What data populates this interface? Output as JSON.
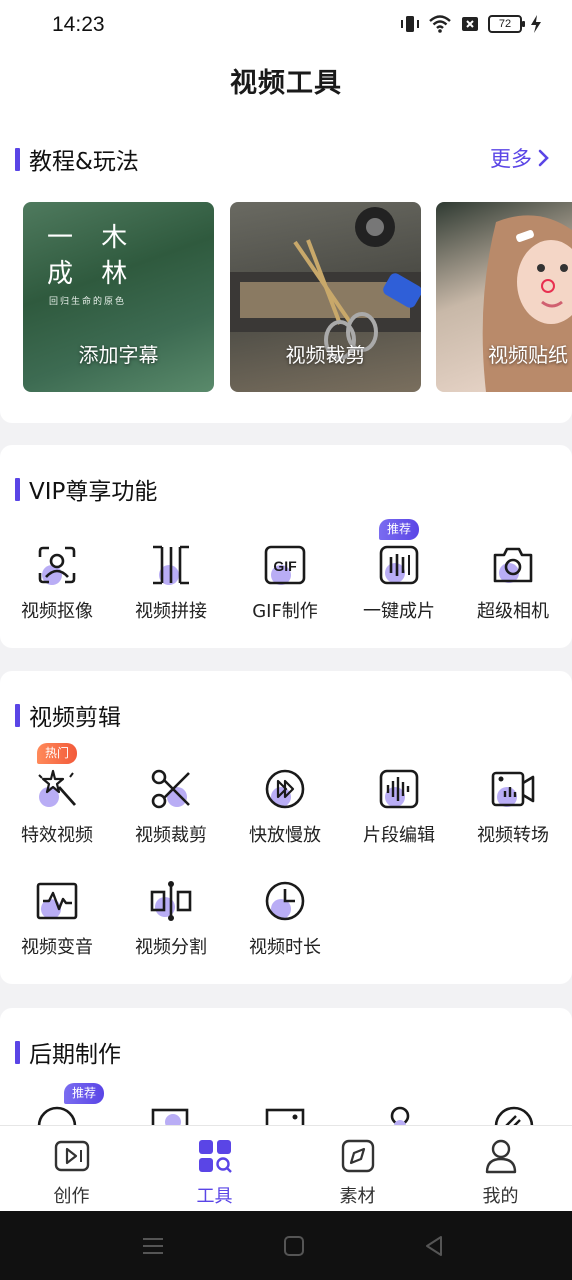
{
  "status": {
    "time": "14:23",
    "battery": "72"
  },
  "title": "视频工具",
  "tutorials": {
    "title": "教程&玩法",
    "more": "更多",
    "forest_line1": "一 木",
    "forest_line2": "成 林",
    "forest_sub": "回归生命的原色",
    "items": [
      {
        "label": "添加字幕"
      },
      {
        "label": "视频裁剪"
      },
      {
        "label": "视频贴纸"
      }
    ]
  },
  "vip": {
    "title": "VIP尊享功能",
    "items": [
      {
        "label": "视频抠像",
        "icon": "portrait-cutout-icon"
      },
      {
        "label": "视频拼接",
        "icon": "splice-icon"
      },
      {
        "label": "GIF制作",
        "icon": "gif-icon",
        "icon_text": "GIF"
      },
      {
        "label": "一键成片",
        "icon": "one-click-film-icon",
        "badge": "推荐"
      },
      {
        "label": "超级相机",
        "icon": "camera-icon"
      }
    ]
  },
  "edit": {
    "title": "视频剪辑",
    "items": [
      {
        "label": "特效视频",
        "icon": "magic-wand-icon",
        "badge": "热门"
      },
      {
        "label": "视频裁剪",
        "icon": "scissors-icon"
      },
      {
        "label": "快放慢放",
        "icon": "fast-forward-icon"
      },
      {
        "label": "片段编辑",
        "icon": "audio-wave-icon"
      },
      {
        "label": "视频转场",
        "icon": "video-camera-icon"
      },
      {
        "label": "视频变音",
        "icon": "voice-change-icon"
      },
      {
        "label": "视频分割",
        "icon": "split-icon"
      },
      {
        "label": "视频时长",
        "icon": "clock-icon"
      }
    ]
  },
  "post": {
    "title": "后期制作",
    "badge": "推荐"
  },
  "tabs": [
    {
      "label": "创作",
      "icon": "create-icon"
    },
    {
      "label": "工具",
      "icon": "tools-icon"
    },
    {
      "label": "素材",
      "icon": "material-icon"
    },
    {
      "label": "我的",
      "icon": "profile-icon"
    }
  ],
  "colors": {
    "accent": "#5a45e6",
    "hot": "#f25a3a"
  }
}
